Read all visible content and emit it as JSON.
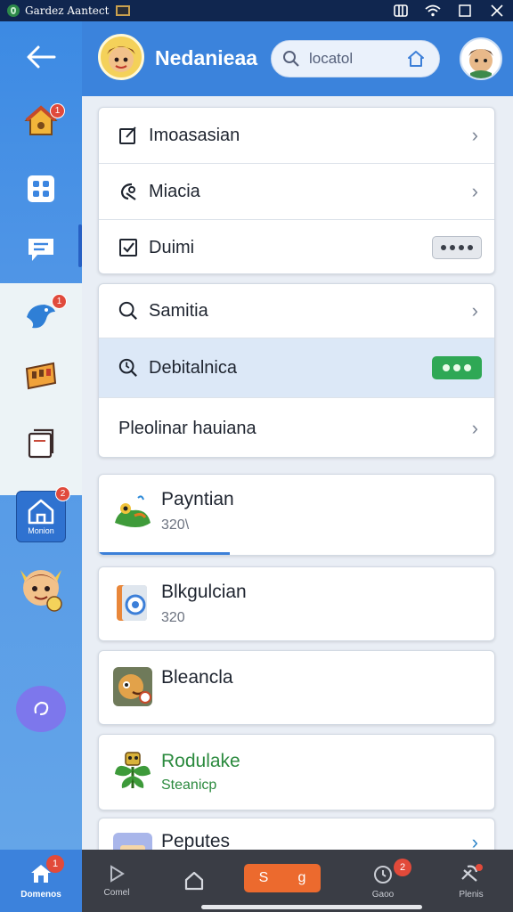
{
  "window": {
    "title": "Gardez Aantect",
    "controls": [
      "restore",
      "wifi",
      "maximize",
      "close"
    ]
  },
  "sidebar": {
    "items": [
      {
        "name": "back",
        "icon": "back-arrow-icon"
      },
      {
        "name": "home",
        "icon": "house-icon",
        "badge": "1"
      },
      {
        "name": "apps",
        "icon": "grid-icon"
      },
      {
        "name": "messages",
        "icon": "chat-icon"
      },
      {
        "name": "bird",
        "icon": "bird-icon",
        "badge": "1"
      },
      {
        "name": "badge",
        "icon": "ticket-icon"
      },
      {
        "name": "notes",
        "icon": "book-icon"
      },
      {
        "name": "monion",
        "icon": "house-tile-icon",
        "label": "Monion",
        "badge": "2"
      },
      {
        "name": "character",
        "icon": "character-icon"
      },
      {
        "name": "refresh",
        "icon": "refresh-icon"
      }
    ]
  },
  "header": {
    "name": "Nedanieaa",
    "search": {
      "placeholder": "locatol"
    }
  },
  "settings": {
    "group1": [
      {
        "label": "Imoasasian",
        "icon": "edit-icon",
        "control": "chevron"
      },
      {
        "label": "Miacia",
        "icon": "tool-icon",
        "control": "chevron"
      },
      {
        "label": "Duimi",
        "icon": "checkbox-icon",
        "control": "dots"
      }
    ],
    "group2": [
      {
        "label": "Samitia",
        "icon": "search-icon",
        "control": "chevron"
      },
      {
        "label": "Debitalnica",
        "icon": "search-timer-icon",
        "control": "toggle-on",
        "highlighted": true
      },
      {
        "label": "Pleolinar hauiana",
        "control": "chevron"
      }
    ]
  },
  "cards": [
    {
      "title": "Payntian",
      "subtitle": "320\\",
      "icon": "frog-icon",
      "progress": 0.33
    },
    {
      "title": "Blkgulcian",
      "subtitle": "320",
      "icon": "washer-icon"
    },
    {
      "title": "Bleancla",
      "subtitle": "",
      "icon": "monkey-icon"
    },
    {
      "title": "Rodulake",
      "subtitle": "Steanicp",
      "icon": "plant-icon",
      "title_color": "#2b8a3e"
    },
    {
      "title": "Peputes",
      "subtitle": "",
      "icon": "cake-icon",
      "chevron_color": "#2f86c9"
    }
  ],
  "bottom_nav": {
    "items": [
      {
        "label": "Domenos",
        "icon": "home-icon",
        "badge": "1",
        "active": true
      },
      {
        "label": "Comel",
        "icon": "play-icon"
      },
      {
        "label": "",
        "icon": "house-outline-icon"
      },
      {
        "label": "Gaoo",
        "icon": "alarm-icon",
        "badge": "2"
      },
      {
        "label": "Plenis",
        "icon": "tools-icon"
      }
    ],
    "center": {
      "left": "S",
      "right": "g"
    }
  }
}
